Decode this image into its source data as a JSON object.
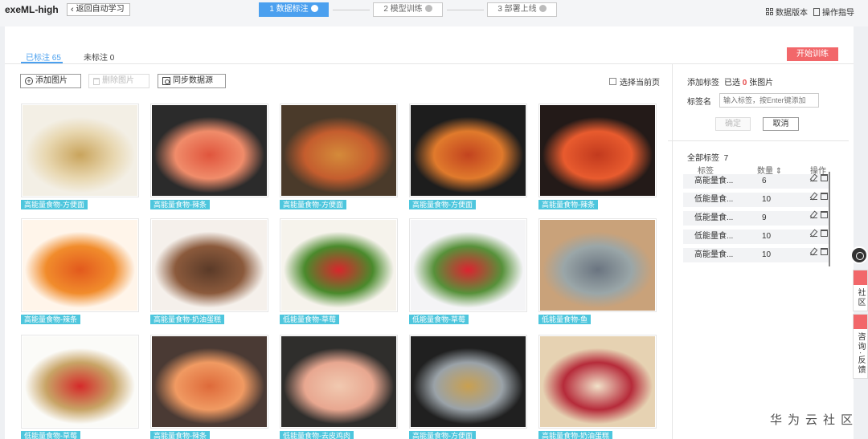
{
  "header": {
    "app_title": "exeML-high",
    "back_label": "返回自动学习",
    "steps": [
      "1 数据标注",
      "2 模型训练",
      "3 部署上线"
    ],
    "active_step": 0,
    "dataset_version": "数据版本",
    "guide": "操作指导"
  },
  "tabs": {
    "labeled": "已标注 65",
    "unlabeled": "未标注 0"
  },
  "start_train": "开始训练",
  "toolbar": {
    "add_image": "添加图片",
    "delete_image": "删除图片",
    "sync_source": "同步数据源",
    "select_page": "选择当前页"
  },
  "images": [
    {
      "tag": "高能量食物-方便面",
      "icon": "noodles-image",
      "colors": [
        "#c9a45c",
        "#e8d7b0",
        "#f3efe5"
      ]
    },
    {
      "tag": "高能量食物-辣条",
      "icon": "spicy-strips-image",
      "colors": [
        "#e0553d",
        "#f08c6a",
        "#2b2b2b"
      ]
    },
    {
      "tag": "高能量食物-方便面",
      "icon": "noodles-image",
      "colors": [
        "#d48b3a",
        "#c45d2e",
        "#4a3a2a"
      ]
    },
    {
      "tag": "高能量食物-方便面",
      "icon": "noodles-image",
      "colors": [
        "#c2431f",
        "#e07a2c",
        "#1d1d1d"
      ]
    },
    {
      "tag": "高能量食物-辣条",
      "icon": "spicy-strips-image",
      "colors": [
        "#c23a1e",
        "#e85b2e",
        "#231a18"
      ]
    },
    {
      "tag": "高能量食物-辣条",
      "icon": "spicy-strips-image",
      "colors": [
        "#e2591d",
        "#f18c2c",
        "#fff5ea"
      ]
    },
    {
      "tag": "高能量食物-奶油蛋糕",
      "icon": "cake-image",
      "colors": [
        "#5a3a28",
        "#8b5a3c",
        "#f5f0eb"
      ]
    },
    {
      "tag": "低能量食物-草莓",
      "icon": "strawberry-image",
      "colors": [
        "#d8262c",
        "#4a8a2c",
        "#f6f3ec"
      ]
    },
    {
      "tag": "低能量食物-草莓",
      "icon": "strawberry-image",
      "colors": [
        "#dc2330",
        "#57913a",
        "#f4f4f6"
      ]
    },
    {
      "tag": "低能量食物-鱼",
      "icon": "fish-image",
      "colors": [
        "#6a7480",
        "#9aa6a8",
        "#c9a27a"
      ]
    },
    {
      "tag": "低能量食物-草莓",
      "icon": "strawberry-image",
      "colors": [
        "#d52a2a",
        "#c8a466",
        "#fbfbf8"
      ]
    },
    {
      "tag": "高能量食物-辣条",
      "icon": "spicy-strips-image",
      "colors": [
        "#de6a3a",
        "#f09a62",
        "#4a3a34"
      ]
    },
    {
      "tag": "低能量食物-去皮鸡肉",
      "icon": "chicken-image",
      "colors": [
        "#f1c9b0",
        "#e8a790",
        "#2f2e2c"
      ]
    },
    {
      "tag": "高能量食物-方便面",
      "icon": "noodles-image",
      "colors": [
        "#c9a050",
        "#9aa2a8",
        "#202020"
      ]
    },
    {
      "tag": "高能量食物-奶油蛋糕",
      "icon": "cake-image",
      "colors": [
        "#f1e1c8",
        "#b62b3a",
        "#e6d2b2"
      ]
    }
  ],
  "sidebar": {
    "add_label": "添加标签",
    "selected_prefix": "已选",
    "selected_count": "0",
    "selected_suffix": "张图片",
    "label_name": "标签名",
    "input_placeholder": "输入标签，按Enter键添加",
    "confirm": "确定",
    "cancel": "取消",
    "all_labels_title": "全部标签",
    "all_labels_count": "7",
    "table_headers": {
      "label": "标签",
      "count": "数量",
      "ops": "操作"
    },
    "rows": [
      {
        "label": "高能量食...",
        "count": "6"
      },
      {
        "label": "低能量食...",
        "count": "10"
      },
      {
        "label": "低能量食...",
        "count": "9"
      },
      {
        "label": "低能量食...",
        "count": "10"
      },
      {
        "label": "高能量食...",
        "count": "10"
      }
    ]
  },
  "floating": {
    "community": "社区",
    "feedback": "咨询·反馈"
  },
  "watermark": "华为云社区"
}
